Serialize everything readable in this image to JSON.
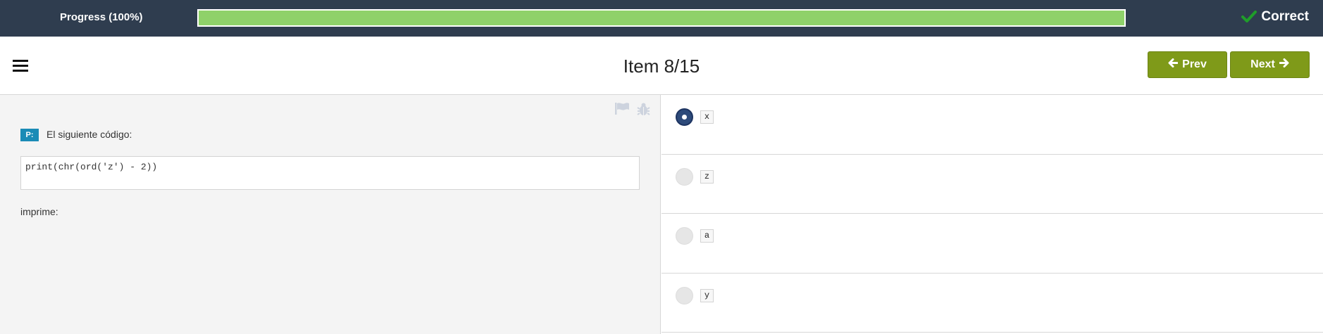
{
  "progress": {
    "label": "Progress (100%)",
    "value": 1.0,
    "fill_color": "#8fd16a"
  },
  "status": {
    "icon": "check-icon",
    "text": "Correct",
    "icon_color": "#1f9d2a"
  },
  "header": {
    "menu_icon": "hamburger-icon",
    "title": "Item 8/15",
    "prev_label": "Prev",
    "next_label": "Next",
    "button_color": "#7f9a19"
  },
  "question": {
    "badge": "P:",
    "prompt": "El siguiente código:",
    "code": "print(chr(ord('z') - 2))",
    "suffix": "imprime:",
    "tools": [
      "flag-icon",
      "bug-icon"
    ]
  },
  "answers": {
    "options": [
      {
        "code": "x",
        "selected": true
      },
      {
        "code": "z",
        "selected": false
      },
      {
        "code": "a",
        "selected": false
      },
      {
        "code": "y",
        "selected": false
      }
    ]
  }
}
